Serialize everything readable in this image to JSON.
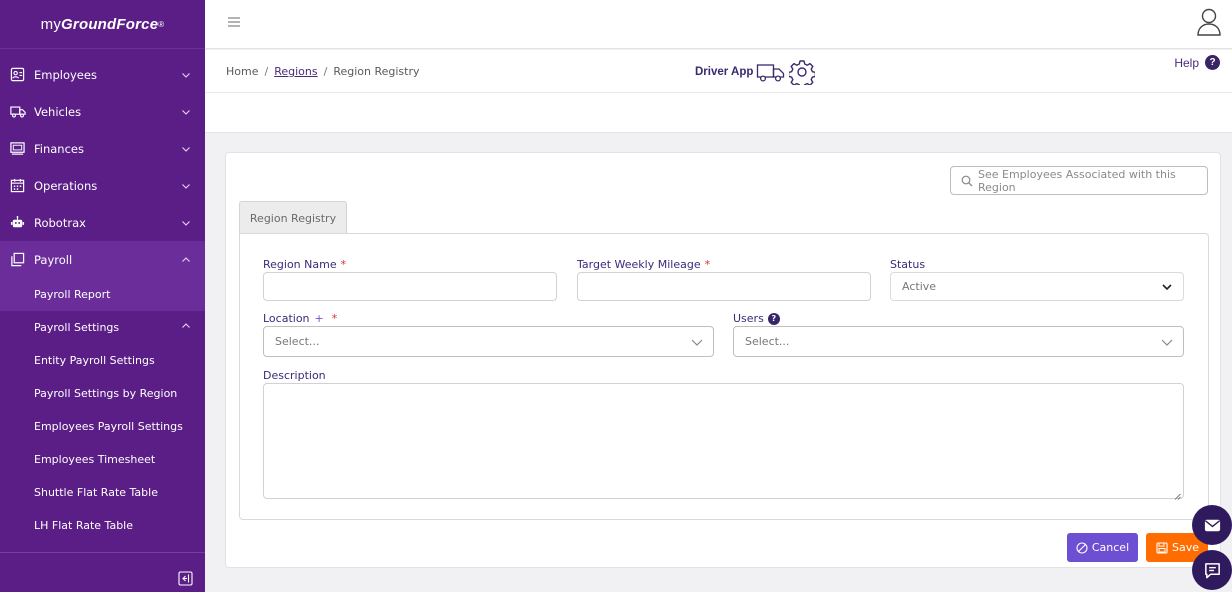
{
  "app": {
    "brand_prefix": "my",
    "brand_bold": "GroundForce",
    "brand_mark": "®"
  },
  "sidebar": {
    "items": [
      {
        "label": "Employees",
        "icon": "employees-icon"
      },
      {
        "label": "Vehicles",
        "icon": "vehicles-icon"
      },
      {
        "label": "Finances",
        "icon": "finances-icon"
      },
      {
        "label": "Operations",
        "icon": "operations-icon"
      },
      {
        "label": "Robotrax",
        "icon": "robotrax-icon"
      },
      {
        "label": "Payroll",
        "icon": "payroll-icon"
      }
    ],
    "payroll_sub": {
      "payroll_report": "Payroll Report",
      "payroll_settings": "Payroll Settings",
      "settings_items": [
        "Entity Payroll Settings",
        "Payroll Settings by Region",
        "Employees Payroll Settings",
        "Employees Timesheet",
        "Shuttle Flat Rate Table",
        "LH Flat Rate Table"
      ]
    }
  },
  "breadcrumb": {
    "home": "Home",
    "separator": "/",
    "regions": "Regions",
    "current": "Region Registry"
  },
  "header": {
    "driver_app": "Driver App",
    "help": "Help",
    "help_badge": "?"
  },
  "card": {
    "see_employees": "See Employees Associated with this Region",
    "tab": "Region Registry"
  },
  "form": {
    "region_name_label": "Region Name",
    "target_mileage_label": "Target Weekly Mileage",
    "status_label": "Status",
    "status_value": "Active",
    "location_label": "Location",
    "location_plus": "+",
    "location_placeholder": "Select...",
    "users_label": "Users",
    "users_info": "?",
    "users_placeholder": "Select...",
    "description_label": "Description",
    "required_mark": "*"
  },
  "actions": {
    "cancel": "Cancel",
    "save": "Save"
  },
  "colors": {
    "sidebar": "#5b1e86",
    "accent": "#3d2a78",
    "cancel": "#6c4fd2",
    "save": "#ff6d00"
  }
}
